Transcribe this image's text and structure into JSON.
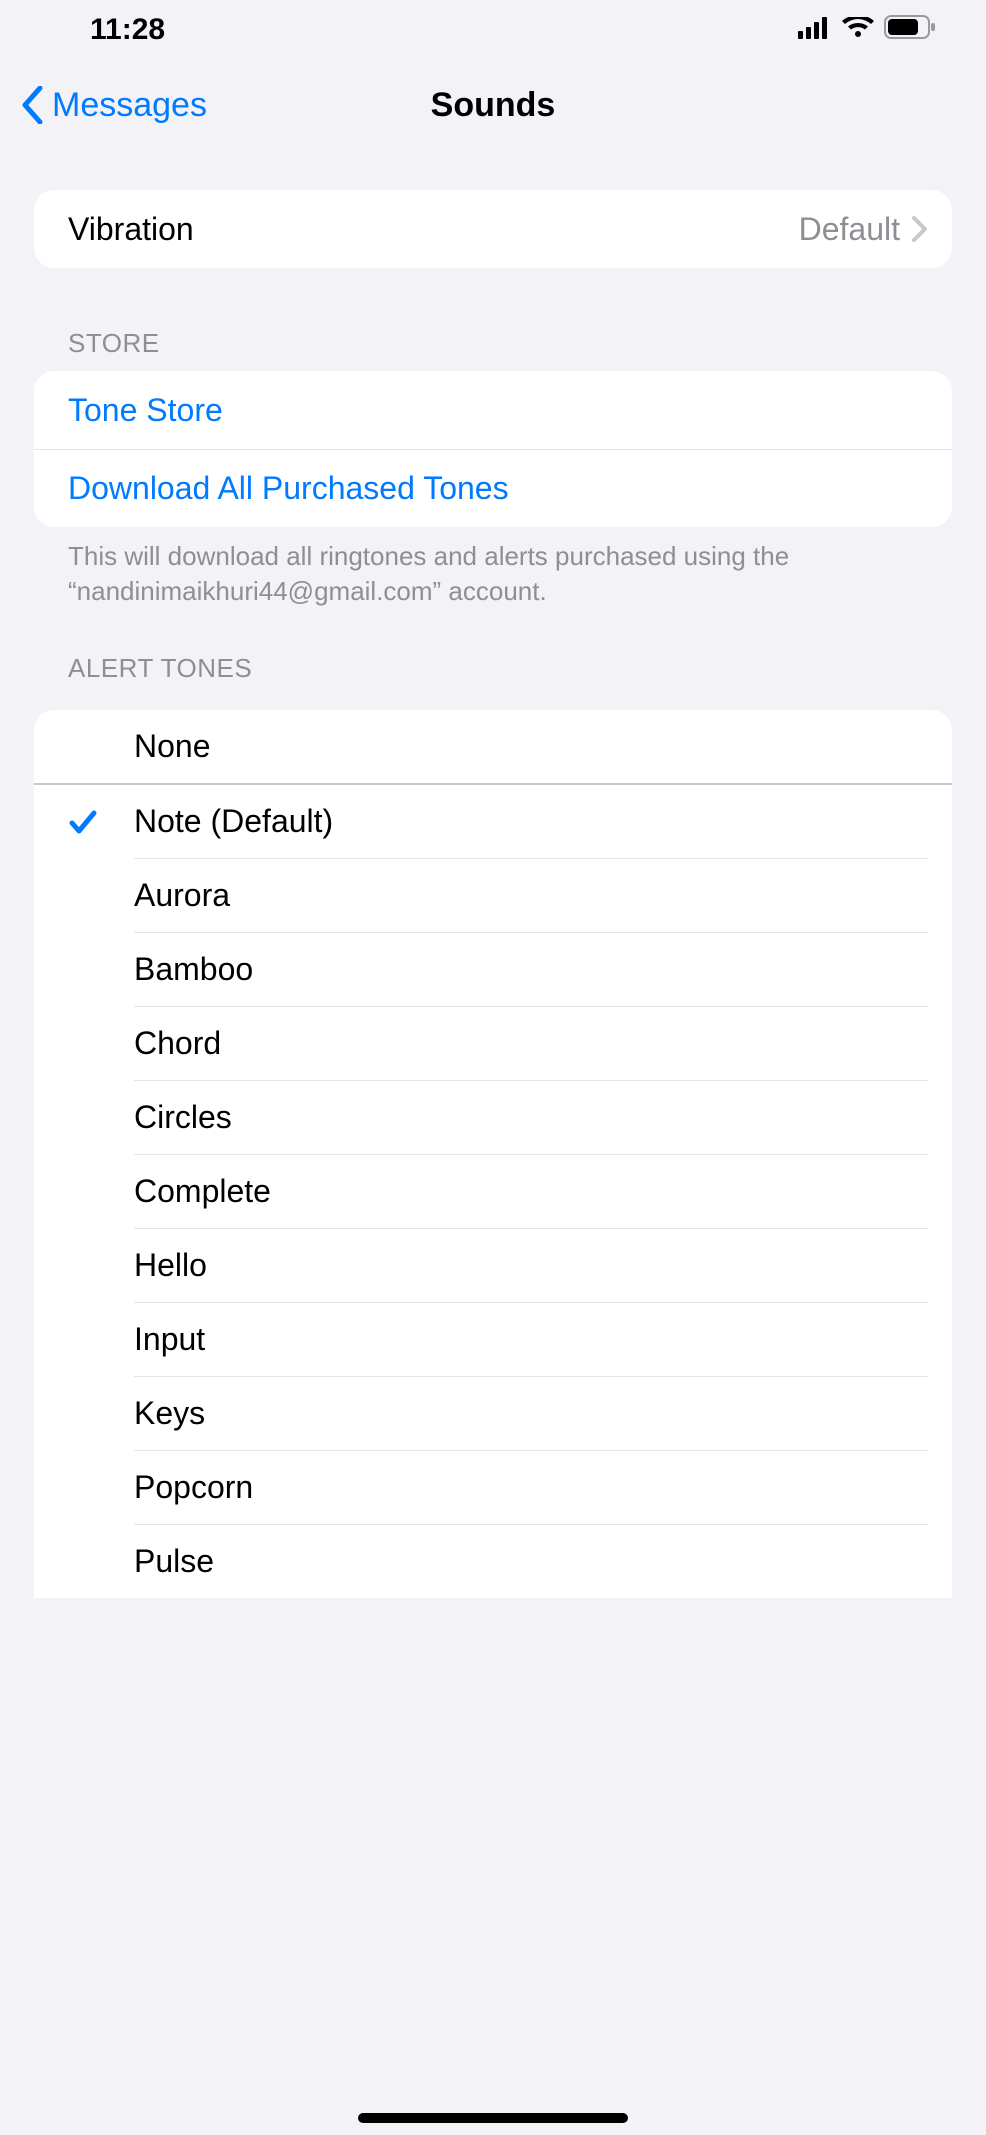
{
  "status": {
    "time": "11:28"
  },
  "nav": {
    "back": "Messages",
    "title": "Sounds"
  },
  "vibration": {
    "label": "Vibration",
    "value": "Default"
  },
  "store": {
    "header": "Store",
    "toneStore": "Tone Store",
    "downloadAll": "Download All Purchased Tones",
    "footer": "This will download all ringtones and alerts purchased using the “nandinimaikhuri44@gmail.com” account."
  },
  "alertTones": {
    "header": "Alert Tones",
    "none": "None",
    "items": [
      {
        "label": "Note (Default)",
        "selected": true
      },
      {
        "label": "Aurora",
        "selected": false
      },
      {
        "label": "Bamboo",
        "selected": false
      },
      {
        "label": "Chord",
        "selected": false
      },
      {
        "label": "Circles",
        "selected": false
      },
      {
        "label": "Complete",
        "selected": false
      },
      {
        "label": "Hello",
        "selected": false
      },
      {
        "label": "Input",
        "selected": false
      },
      {
        "label": "Keys",
        "selected": false
      },
      {
        "label": "Popcorn",
        "selected": false
      },
      {
        "label": "Pulse",
        "selected": false
      }
    ]
  }
}
